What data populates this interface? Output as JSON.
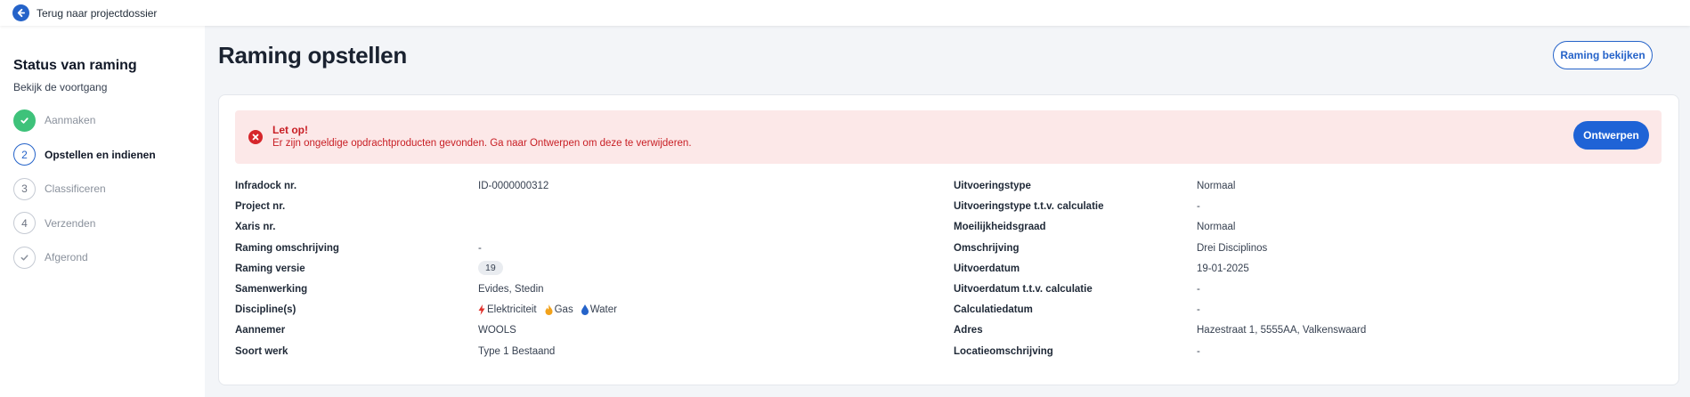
{
  "topbar": {
    "back_label": "Terug naar projectdossier"
  },
  "sidebar": {
    "title": "Status van raming",
    "subtitle": "Bekijk de voortgang",
    "steps": [
      {
        "number": "",
        "label": "Aanmaken",
        "state": "done"
      },
      {
        "number": "2",
        "label": "Opstellen en indienen",
        "state": "active"
      },
      {
        "number": "3",
        "label": "Classificeren",
        "state": "pending"
      },
      {
        "number": "4",
        "label": "Verzenden",
        "state": "pending"
      },
      {
        "number": "",
        "label": "Afgerond",
        "state": "pending-check"
      }
    ]
  },
  "main": {
    "title": "Raming opstellen",
    "view_button": "Raming bekijken"
  },
  "alert": {
    "title": "Let op!",
    "text": "Er zijn ongeldige opdrachtproducten gevonden. Ga naar Ontwerpen om deze te verwijderen.",
    "button": "Ontwerpen"
  },
  "details_left": [
    {
      "label": "Infradock nr.",
      "value": "ID-0000000312"
    },
    {
      "label": "Project nr.",
      "value": ""
    },
    {
      "label": "Xaris nr.",
      "value": ""
    },
    {
      "label": "Raming omschrijving",
      "value": "-"
    },
    {
      "label": "Raming versie",
      "value": "19"
    },
    {
      "label": "Samenwerking",
      "value": "Evides, Stedin"
    },
    {
      "label": "Discipline(s)",
      "value": ""
    },
    {
      "label": "Aannemer",
      "value": "WOOLS"
    },
    {
      "label": "Soort werk",
      "value": "Type 1 Bestaand"
    }
  ],
  "disciplines": [
    {
      "icon": "lightning-icon",
      "label": "Elektriciteit",
      "color": "#e0312b"
    },
    {
      "icon": "flame-icon",
      "label": "Gas",
      "color": "#f2a21b"
    },
    {
      "icon": "water-drop-icon",
      "label": "Water",
      "color": "#2563c9"
    }
  ],
  "details_right": [
    {
      "label": "Uitvoeringstype",
      "value": "Normaal"
    },
    {
      "label": "Uitvoeringstype t.t.v. calculatie",
      "value": "-"
    },
    {
      "label": "Moeilijkheidsgraad",
      "value": "Normaal"
    },
    {
      "label": "Omschrijving",
      "value": "Drei Disciplinos"
    },
    {
      "label": "Uitvoerdatum",
      "value": "19-01-2025"
    },
    {
      "label": "Uitvoerdatum t.t.v. calculatie",
      "value": "-"
    },
    {
      "label": "Calculatiedatum",
      "value": "-"
    },
    {
      "label": "Adres",
      "value": "Hazestraat 1, 5555AA, Valkenswaard"
    },
    {
      "label": "Locatieomschrijving",
      "value": "-"
    }
  ],
  "colors": {
    "primary": "#1f63d6",
    "success": "#3ec27a",
    "danger": "#d6262b",
    "alert_bg": "#fce8e8"
  }
}
